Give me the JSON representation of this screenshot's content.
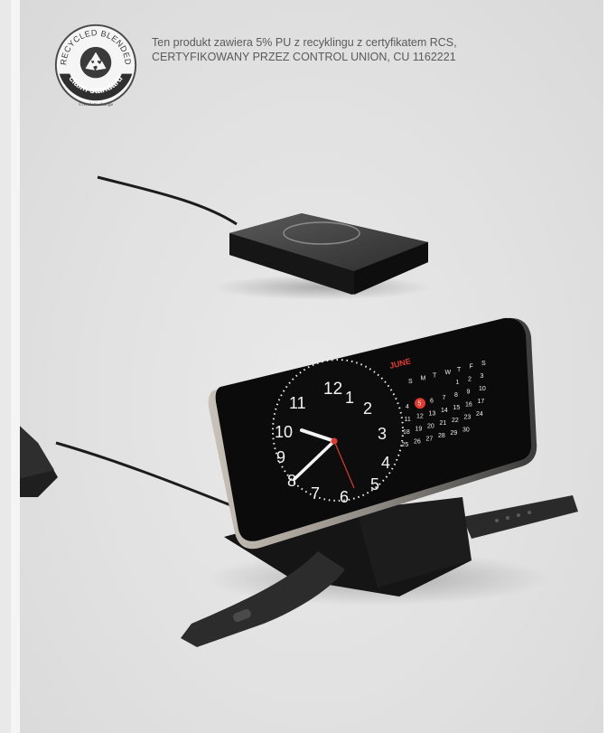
{
  "certification": {
    "logo": {
      "top_text": "RECYCLED BLENDED",
      "bottom_text": "claim standard",
      "credit": "©TextileExchange",
      "icon": "recycle-icon"
    },
    "lines": [
      "Ten produkt zawiera 5% PU z recyklingu z certyfikatem RCS,",
      "CERTYFIKOWANY PRZEZ CONTROL UNION, CU 1162221"
    ]
  },
  "phone_screen": {
    "month": "JUNE",
    "weekdays": [
      "S",
      "M",
      "T",
      "W",
      "T",
      "F",
      "S"
    ],
    "days": [
      "1",
      "2",
      "3",
      "4",
      "5",
      "6",
      "7",
      "8",
      "9",
      "10",
      "11",
      "12",
      "13",
      "14",
      "15",
      "16",
      "17",
      "18",
      "19",
      "20",
      "21",
      "22",
      "23",
      "24",
      "25",
      "26",
      "27",
      "28",
      "29",
      "30"
    ],
    "highlighted_day": "5",
    "clock_numbers": [
      "12",
      "1",
      "2",
      "3",
      "4",
      "5",
      "6",
      "7",
      "8",
      "9",
      "10",
      "11"
    ]
  },
  "colors": {
    "accent_red": "#e23a2e",
    "device_black": "#1b1b1b",
    "background": "#e3e3e3"
  }
}
